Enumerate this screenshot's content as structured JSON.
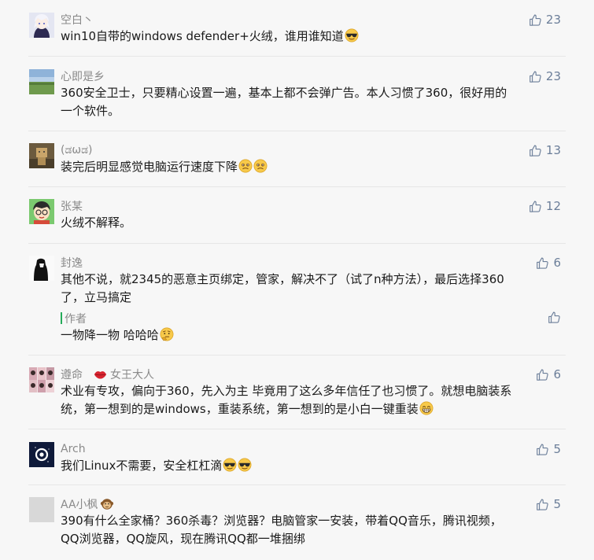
{
  "comments": [
    {
      "name": "空白丶",
      "likes": "23",
      "text": "win10自带的windows defender+火绒，谁用谁知道"
    },
    {
      "name": "心即是乡",
      "likes": "23",
      "text_lines": [
        "360安全卫士，只要精心设置一遍，基本上都不会弹广告。本人习惯了360，很好用的",
        "一个软件。"
      ]
    },
    {
      "name": "(ಡωಡ)",
      "likes": "13",
      "text": "装完后明显感觉电脑运行速度下降"
    },
    {
      "name": "张某",
      "likes": "12",
      "text": "火绒不解释。"
    },
    {
      "name": "封逸",
      "likes": "6",
      "text_lines": [
        "其他不说，就2345的恶意主页绑定，管家，解决不了（试了n种方法），最后选择360",
        "了，立马搞定"
      ],
      "reply": {
        "label": "作者",
        "text": "一物降一物 哈哈哈"
      }
    },
    {
      "name": "遵命",
      "badge": "女王大人",
      "likes": "6",
      "text_lines": [
        "术业有专攻，偏向于360，先入为主 毕竟用了这么多年信任了也习惯了。就想电脑装系",
        "统，第一想到的是windows，重装系统，第一想到的是小白一键重装"
      ]
    },
    {
      "name": "Arch",
      "likes": "5",
      "text": "我们Linux不需要，安全杠杠滴"
    },
    {
      "name": "AA小枫",
      "likes": "5",
      "text_lines": [
        "390有什么全家桶？360杀毒？浏览器？电脑管家一安装，带着QQ音乐，腾讯视频，",
        "QQ浏览器，QQ旋风，现在腾讯QQ都一堆捆绑"
      ]
    }
  ],
  "icons": {
    "like": "thumbs-up-icon",
    "cool": "sunglasses-emoji",
    "wince": "wincing-emoji",
    "think": "thinking-emoji",
    "grin": "grinning-emoji",
    "monkey": "monkey-emoji",
    "lips": "lips-emoji"
  },
  "colors": {
    "like": "#6b7e99",
    "author_bar": "#25ab5a",
    "name": "#8a8a8a"
  }
}
